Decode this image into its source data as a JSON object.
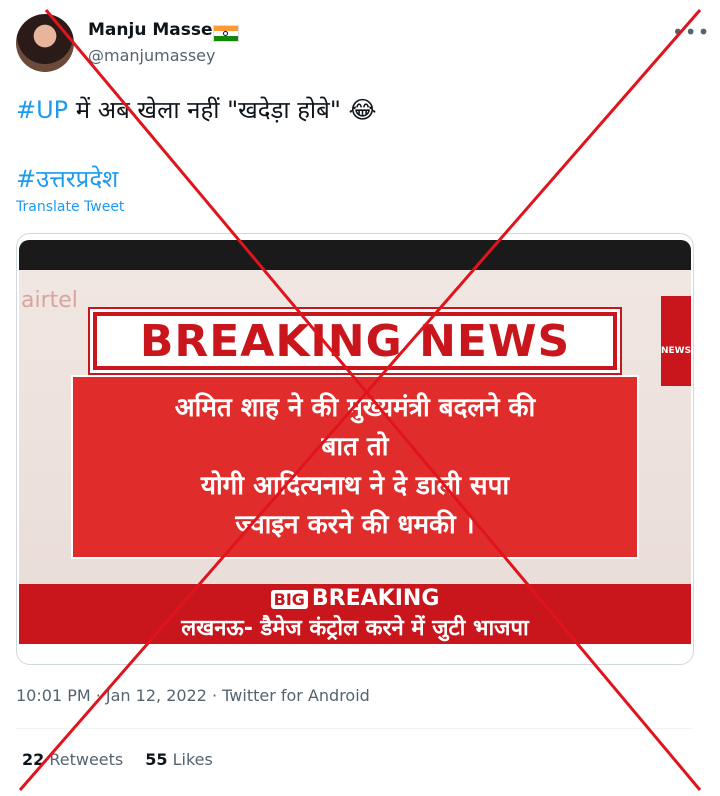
{
  "author": {
    "display_name": "Manju Massey",
    "handle": "@manjumassey",
    "flag_icon": "india-flag-icon"
  },
  "more_label": "•••",
  "tweet": {
    "hashtag_up": "#UP",
    "text": " में अब खेला नहीं \"खदेड़ा होबे\" ",
    "emoji": "😂",
    "hashtag_state": "#उत्तरप्रदेश",
    "translate_label": "Translate Tweet"
  },
  "media": {
    "channel_logo_text": "airtel",
    "side_logo_text": "NEWS",
    "headline": "BREAKING NEWS",
    "body_lines": [
      "अमित शाह ने की मुख्यमंत्री बदलने की",
      "बात तो",
      "योगी आदित्यनाथ ने दे डाली सपा",
      "ज्वाइन करने की धमकी ।"
    ],
    "big_tag": "BIG",
    "big_breaking": "BREAKING",
    "ticker": "लखनऊ- डैमेज कंट्रोल करने में जुटी भाजपा"
  },
  "meta": "10:01 PM · Jan 12, 2022 · Twitter for Android",
  "stats": {
    "retweets_count": "22",
    "retweets_label": "Retweets",
    "likes_count": "55",
    "likes_label": "Likes"
  },
  "overlay": {
    "cross_color": "#e0141c"
  }
}
